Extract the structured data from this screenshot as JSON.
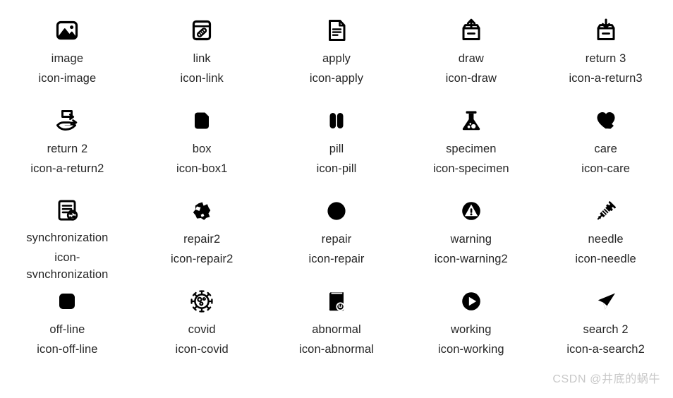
{
  "page": {
    "background_color": "#ffffff",
    "text_color": "#262626",
    "icon_color": "#000000",
    "watermark": "CSDN @井底的蜗牛"
  },
  "icons": [
    {
      "title": "image",
      "class_name": "icon-image",
      "glyph": "image-icon"
    },
    {
      "title": "link",
      "class_name": "icon-link",
      "glyph": "link-icon"
    },
    {
      "title": "apply",
      "class_name": "icon-apply",
      "glyph": "apply-document-icon"
    },
    {
      "title": "draw",
      "class_name": "icon-draw",
      "glyph": "draw-upload-box-icon"
    },
    {
      "title": "return 3",
      "class_name": "icon-a-return3",
      "glyph": "return3-download-box-icon"
    },
    {
      "title": "return 2",
      "class_name": "icon-a-return2",
      "glyph": "return2-hand-icon"
    },
    {
      "title": "box",
      "class_name": "icon-box1",
      "glyph": "box-icon"
    },
    {
      "title": "pill",
      "class_name": "icon-pill",
      "glyph": "pill-icon"
    },
    {
      "title": "specimen",
      "class_name": "icon-specimen",
      "glyph": "specimen-flask-icon"
    },
    {
      "title": "care",
      "class_name": "icon-care",
      "glyph": "care-heart-icon"
    },
    {
      "title": "synchronization",
      "class_name": "icon-synchronization",
      "glyph": "synchronization-icon"
    },
    {
      "title": "repair2",
      "class_name": "icon-repair2",
      "glyph": "repair2-icon"
    },
    {
      "title": "repair",
      "class_name": "icon-repair",
      "glyph": "repair-circle-icon"
    },
    {
      "title": "warning",
      "class_name": "icon-warning2",
      "glyph": "warning-icon"
    },
    {
      "title": "needle",
      "class_name": "icon-needle",
      "glyph": "needle-syringe-icon"
    },
    {
      "title": "off-line",
      "class_name": "icon-off-line",
      "glyph": "off-line-square-icon"
    },
    {
      "title": "covid",
      "class_name": "icon-covid",
      "glyph": "covid-virus-icon"
    },
    {
      "title": "abnormal",
      "class_name": "icon-abnormal",
      "glyph": "abnormal-book-icon"
    },
    {
      "title": "working",
      "class_name": "icon-working",
      "glyph": "working-play-icon"
    },
    {
      "title": "search 2",
      "class_name": "icon-a-search2",
      "glyph": "search2-arrow-icon"
    }
  ]
}
